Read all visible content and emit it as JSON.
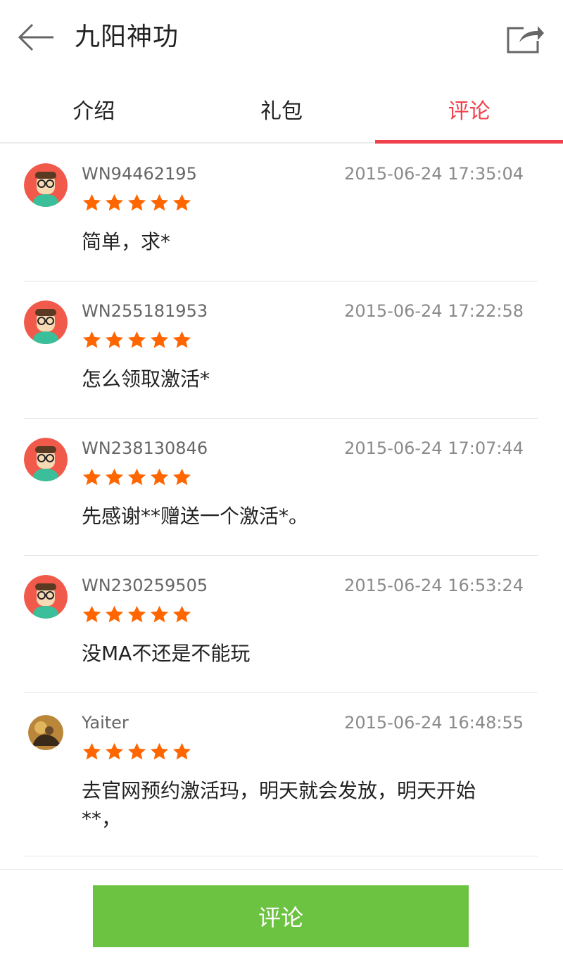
{
  "header": {
    "title": "九阳神功",
    "back_icon": "arrow-left-icon",
    "share_icon": "share-icon"
  },
  "tabs": [
    {
      "label": "介绍",
      "active": false
    },
    {
      "label": "礼包",
      "active": false
    },
    {
      "label": "评论",
      "active": true
    }
  ],
  "colors": {
    "accent": "#f0424c",
    "star": "#ff6600",
    "button": "#6cc241"
  },
  "comments": [
    {
      "user": "WN94462195",
      "time": "2015-06-24 17:35:04",
      "rating": 5,
      "text": "简单，求*",
      "avatar": "cartoon-avatar"
    },
    {
      "user": "WN255181953",
      "time": "2015-06-24 17:22:58",
      "rating": 5,
      "text": "怎么领取激活*",
      "avatar": "cartoon-avatar"
    },
    {
      "user": "WN238130846",
      "time": "2015-06-24 17:07:44",
      "rating": 5,
      "text": "先感谢**赠送一个激活*。",
      "avatar": "cartoon-avatar"
    },
    {
      "user": "WN230259505",
      "time": "2015-06-24 16:53:24",
      "rating": 5,
      "text": "没MA不还是不能玩",
      "avatar": "cartoon-avatar"
    },
    {
      "user": "Yaiter",
      "time": "2015-06-24 16:48:55",
      "rating": 5,
      "text": "去官网预约激活玛，明天就会发放，明天开始**，",
      "avatar": "photo-avatar"
    }
  ],
  "bottom": {
    "comment_button": "评论"
  }
}
